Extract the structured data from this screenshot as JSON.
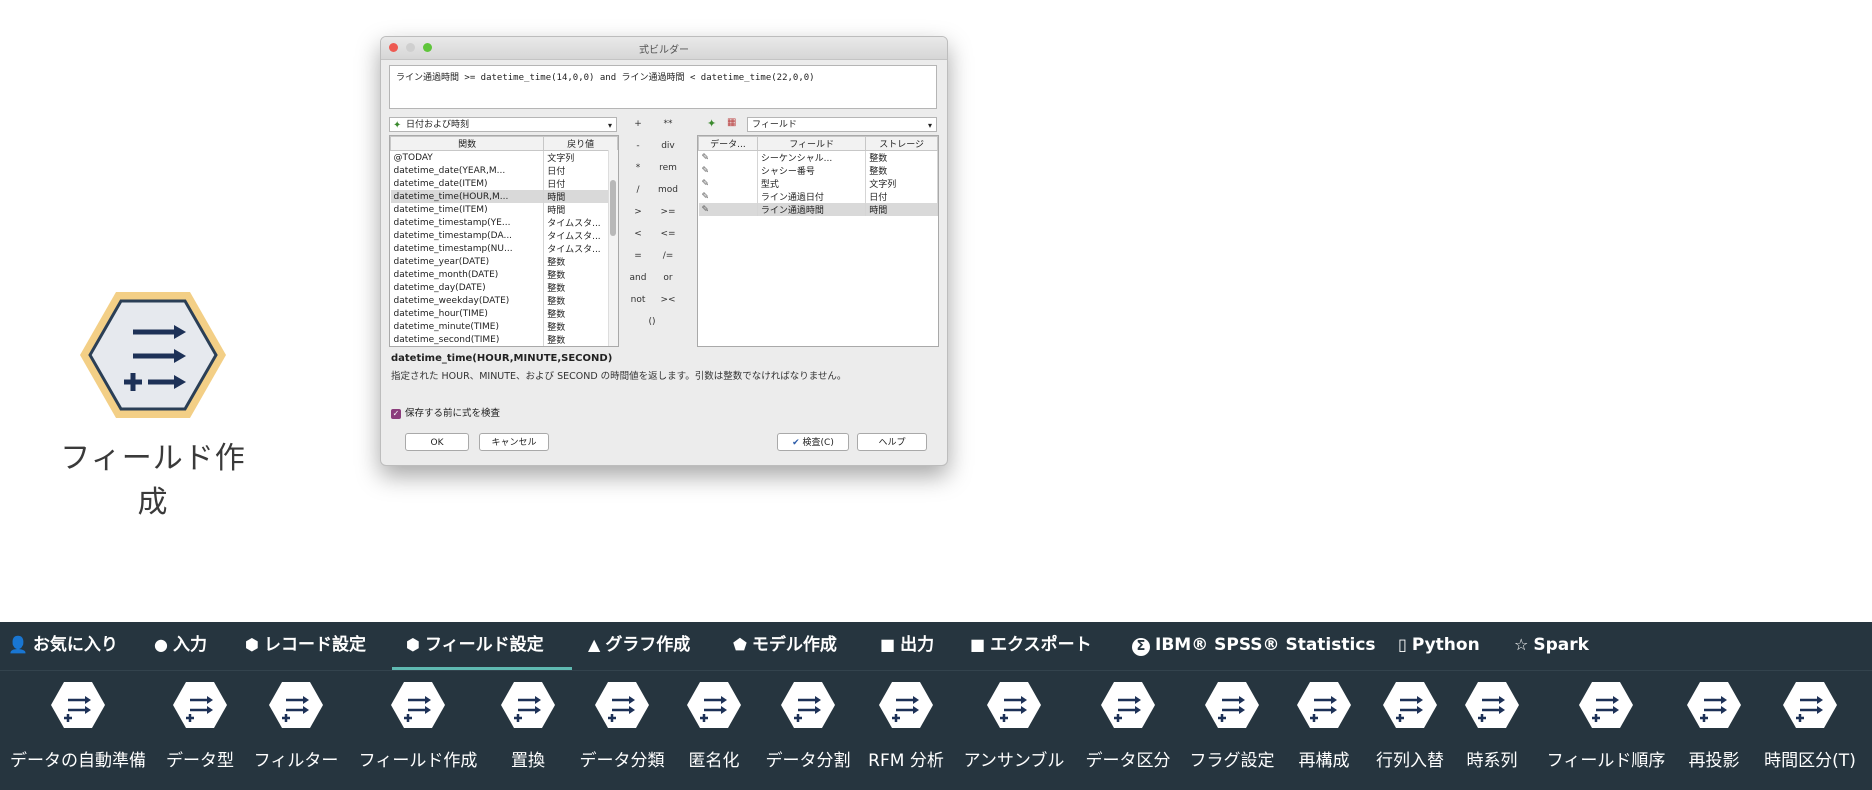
{
  "main_node": {
    "caption": "フィールド作成",
    "icon": "field-derive-icon"
  },
  "dialog": {
    "title": "式ビルダー",
    "expression": "ライン通過時間  >=  datetime_time(14,0,0)  and  ライン通過時間   <   datetime_time(22,0,0)",
    "function_group": "日付および時刻",
    "function_table": {
      "headers": [
        "関数",
        "戻り値"
      ],
      "rows": [
        [
          "@TODAY",
          "文字列"
        ],
        [
          "datetime_date(YEAR,M...",
          "日付"
        ],
        [
          "datetime_date(ITEM)",
          "日付"
        ],
        [
          "datetime_time(HOUR,M...",
          "時間"
        ],
        [
          "datetime_time(ITEM)",
          "時間"
        ],
        [
          "datetime_timestamp(YE...",
          "タイムスタ..."
        ],
        [
          "datetime_timestamp(DA...",
          "タイムスタ..."
        ],
        [
          "datetime_timestamp(NU...",
          "タイムスタ..."
        ],
        [
          "datetime_year(DATE)",
          "整数"
        ],
        [
          "datetime_month(DATE)",
          "整数"
        ],
        [
          "datetime_day(DATE)",
          "整数"
        ],
        [
          "datetime_weekday(DATE)",
          "整数"
        ],
        [
          "datetime_hour(TIME)",
          "整数"
        ],
        [
          "datetime_minute(TIME)",
          "整数"
        ],
        [
          "datetime_second(TIME)",
          "整数"
        ]
      ],
      "selected_row": 3
    },
    "operators": [
      "+",
      "**",
      "-",
      "div",
      "*",
      "rem",
      "/",
      "mod",
      ">",
      ">=",
      "<",
      "<=",
      "=",
      "/=",
      "and",
      "or",
      "not",
      "><",
      "()"
    ],
    "field_group": "フィールド",
    "field_table": {
      "headers": [
        "データ...",
        "フィールド",
        "ストレージ"
      ],
      "rows": [
        [
          "",
          "シーケンシャル...",
          "整数"
        ],
        [
          "",
          "シャシー番号",
          "整数"
        ],
        [
          "",
          "型式",
          "文字列"
        ],
        [
          "",
          "ライン通過日付",
          "日付"
        ],
        [
          "",
          "ライン通過時間",
          "時間"
        ]
      ],
      "selected_row": 4
    },
    "function_signature": "datetime_time(HOUR,MINUTE,SECOND)",
    "function_description": "指定された HOUR、MINUTE、および SECOND の時間値を返します。引数は整数でなければなりません。",
    "checkbox_label": "保存する前に式を検査",
    "buttons": {
      "ok": "OK",
      "cancel": "キャンセル",
      "check": "検査(C)",
      "help": "ヘルプ"
    }
  },
  "palette": {
    "tabs": [
      {
        "label": "お気に入り",
        "icon": "person-icon"
      },
      {
        "label": "入力",
        "icon": "circle-icon"
      },
      {
        "label": "レコード設定",
        "icon": "hexagon-icon"
      },
      {
        "label": "フィールド設定",
        "icon": "hexagon-icon",
        "active": true
      },
      {
        "label": "グラフ作成",
        "icon": "triangle-icon"
      },
      {
        "label": "モデル作成",
        "icon": "pentagon-icon"
      },
      {
        "label": "出力",
        "icon": "square-icon"
      },
      {
        "label": "エクスポート",
        "icon": "square-icon"
      },
      {
        "label": "IBM® SPSS® Statistics",
        "icon": "sigma-icon"
      },
      {
        "label": "Python",
        "icon": "python-icon"
      },
      {
        "label": "Spark",
        "icon": "star-icon"
      }
    ],
    "nodes": [
      {
        "label": "データの自動準備",
        "icon": "auto-data-prep-icon"
      },
      {
        "label": "データ型",
        "icon": "type-icon"
      },
      {
        "label": "フィルター",
        "icon": "filter-icon"
      },
      {
        "label": "フィールド作成",
        "icon": "derive-icon"
      },
      {
        "label": "置換",
        "icon": "filler-icon"
      },
      {
        "label": "データ分類",
        "icon": "reclassify-icon"
      },
      {
        "label": "匿名化",
        "icon": "anonymize-icon"
      },
      {
        "label": "データ分割",
        "icon": "binning-icon"
      },
      {
        "label": "RFM 分析",
        "icon": "rfm-icon"
      },
      {
        "label": "アンサンブル",
        "icon": "ensemble-icon"
      },
      {
        "label": "データ区分",
        "icon": "partition-icon"
      },
      {
        "label": "フラグ設定",
        "icon": "set-to-flag-icon"
      },
      {
        "label": "再構成",
        "icon": "restructure-icon"
      },
      {
        "label": "行列入替",
        "icon": "transpose-icon"
      },
      {
        "label": "時系列",
        "icon": "time-intervals-icon"
      },
      {
        "label": "フィールド順序",
        "icon": "field-reorder-icon"
      },
      {
        "label": "再投影",
        "icon": "reprojection-icon"
      },
      {
        "label": "時間区分(T)",
        "icon": "time-partition-icon"
      }
    ]
  }
}
